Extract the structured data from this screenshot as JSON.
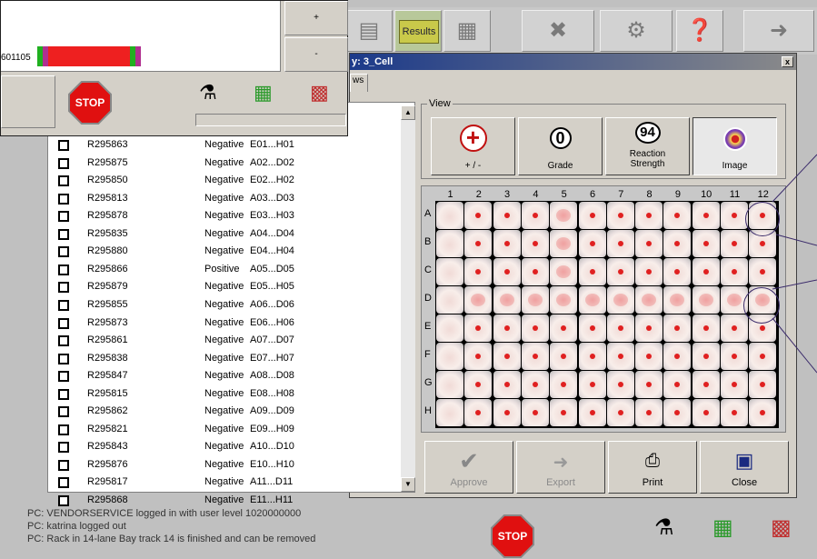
{
  "toolbar": {
    "results_label": "Results",
    "icons": [
      "reports-icon",
      "folder-icon",
      "tools-icon",
      "settings-icon",
      "help-book-icon",
      "exit-icon"
    ]
  },
  "dialog": {
    "title": "y: 3_Cell",
    "tab_label": "ws",
    "close_glyph": "x"
  },
  "list": {
    "rows": [
      {
        "id": "R295863",
        "result": "Negative",
        "wells": "E01...H01"
      },
      {
        "id": "R295875",
        "result": "Negative",
        "wells": "A02...D02"
      },
      {
        "id": "R295850",
        "result": "Negative",
        "wells": "E02...H02"
      },
      {
        "id": "R295813",
        "result": "Negative",
        "wells": "A03...D03"
      },
      {
        "id": "R295878",
        "result": "Negative",
        "wells": "E03...H03"
      },
      {
        "id": "R295835",
        "result": "Negative",
        "wells": "A04...D04"
      },
      {
        "id": "R295880",
        "result": "Negative",
        "wells": "E04...H04"
      },
      {
        "id": "R295866",
        "result": "Positive",
        "wells": "A05...D05"
      },
      {
        "id": "R295879",
        "result": "Negative",
        "wells": "E05...H05"
      },
      {
        "id": "R295855",
        "result": "Negative",
        "wells": "A06...D06"
      },
      {
        "id": "R295873",
        "result": "Negative",
        "wells": "E06...H06"
      },
      {
        "id": "R295861",
        "result": "Negative",
        "wells": "A07...D07"
      },
      {
        "id": "R295838",
        "result": "Negative",
        "wells": "E07...H07"
      },
      {
        "id": "R295847",
        "result": "Negative",
        "wells": "A08...D08"
      },
      {
        "id": "R295815",
        "result": "Negative",
        "wells": "E08...H08"
      },
      {
        "id": "R295862",
        "result": "Negative",
        "wells": "A09...D09"
      },
      {
        "id": "R295821",
        "result": "Negative",
        "wells": "E09...H09"
      },
      {
        "id": "R295843",
        "result": "Negative",
        "wells": "A10...D10"
      },
      {
        "id": "R295876",
        "result": "Negative",
        "wells": "E10...H10"
      },
      {
        "id": "R295817",
        "result": "Negative",
        "wells": "A11...D11"
      },
      {
        "id": "R295868",
        "result": "Negative",
        "wells": "E11...H11"
      }
    ]
  },
  "view": {
    "legend": "View",
    "buttons": [
      {
        "name": "plus-minus",
        "symbol": "+",
        "label": "+ / -"
      },
      {
        "name": "grade",
        "symbol": "0",
        "label": "Grade"
      },
      {
        "name": "reaction-strength",
        "symbol": "94",
        "label": "Reaction Strength"
      },
      {
        "name": "image",
        "symbol": "",
        "label": "Image"
      }
    ]
  },
  "plate": {
    "columns": [
      "1",
      "2",
      "3",
      "4",
      "5",
      "6",
      "7",
      "8",
      "9",
      "10",
      "11",
      "12"
    ],
    "rows": [
      "A",
      "B",
      "C",
      "D",
      "E",
      "F",
      "G",
      "H"
    ]
  },
  "actions": {
    "approve": "Approve",
    "export": "Export",
    "print": "Print",
    "close": "Close"
  },
  "popup": {
    "sample_id": "601105",
    "plus": "+",
    "minus": "-",
    "stop_label": "STOP"
  },
  "status": {
    "lines": [
      "PC: VENDORSERVICE logged in with user level 1020000000",
      "PC: katrina logged out",
      "PC: Rack in 14-lane Bay track 14 is finished and can be removed"
    ],
    "stop_label": "STOP"
  },
  "colors": {
    "title_bar": "#1c3a8a",
    "stop": "#e01010",
    "well_blue_grid": "#2a3aa8",
    "well_red_grid": "#d02020"
  }
}
